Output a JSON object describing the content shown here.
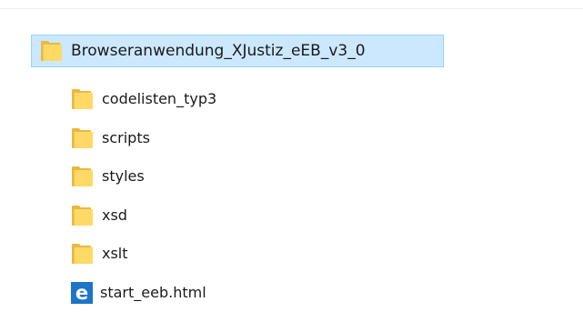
{
  "tree": {
    "root": {
      "label": "Browseranwendung_XJustiz_eEB_v3_0",
      "icon": "folder-icon"
    },
    "items": [
      {
        "label": "codelisten_typ3",
        "icon": "folder-icon"
      },
      {
        "label": "scripts",
        "icon": "folder-icon"
      },
      {
        "label": "styles",
        "icon": "folder-icon"
      },
      {
        "label": "xsd",
        "icon": "folder-icon"
      },
      {
        "label": "xslt",
        "icon": "folder-icon"
      },
      {
        "label": "start_eeb.html",
        "icon": "edge-html-file-icon"
      }
    ]
  },
  "colors": {
    "selection_bg": "#cce8ff",
    "selection_border": "#99d1ff",
    "folder": "#ffd966",
    "edge_blue": "#1e74c6"
  }
}
